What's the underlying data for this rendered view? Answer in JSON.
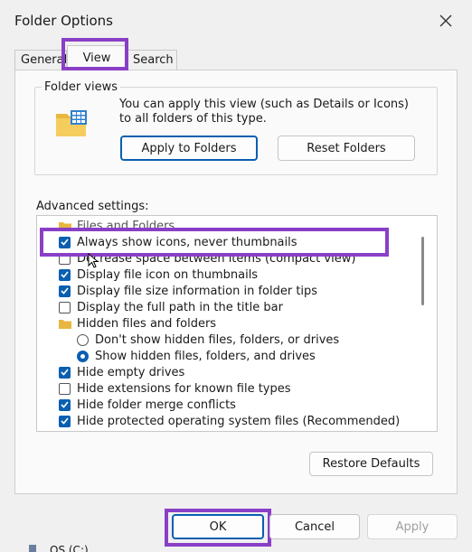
{
  "window": {
    "title": "Folder Options"
  },
  "tabs": [
    {
      "label": "General"
    },
    {
      "label": "View"
    },
    {
      "label": "Search"
    }
  ],
  "folder_views": {
    "legend": "Folder views",
    "description": "You can apply this view (such as Details or Icons) to all folders of this type.",
    "apply_button": "Apply to Folders",
    "reset_button": "Reset Folders",
    "icon": "folder-grid-icon"
  },
  "advanced": {
    "label": "Advanced settings:",
    "items": [
      {
        "type": "folder",
        "label": "Files and Folders"
      },
      {
        "type": "checkbox",
        "checked": true,
        "label": "Always show icons, never thumbnails"
      },
      {
        "type": "checkbox",
        "checked": false,
        "label": "Decrease space between items (compact view)"
      },
      {
        "type": "checkbox",
        "checked": true,
        "label": "Display file icon on thumbnails"
      },
      {
        "type": "checkbox",
        "checked": true,
        "label": "Display file size information in folder tips"
      },
      {
        "type": "checkbox",
        "checked": false,
        "label": "Display the full path in the title bar"
      },
      {
        "type": "folder",
        "label": "Hidden files and folders"
      },
      {
        "type": "radio",
        "checked": false,
        "label": "Don't show hidden files, folders, or drives"
      },
      {
        "type": "radio",
        "checked": true,
        "label": "Show hidden files, folders, and drives"
      },
      {
        "type": "checkbox",
        "checked": true,
        "label": "Hide empty drives"
      },
      {
        "type": "checkbox",
        "checked": false,
        "label": "Hide extensions for known file types"
      },
      {
        "type": "checkbox",
        "checked": true,
        "label": "Hide folder merge conflicts"
      },
      {
        "type": "checkbox",
        "checked": true,
        "label": "Hide protected operating system files (Recommended)"
      }
    ],
    "restore_button": "Restore Defaults"
  },
  "footer": {
    "ok": "OK",
    "cancel": "Cancel",
    "apply": "Apply",
    "behind_text": "OS (C:)"
  },
  "colors": {
    "accent": "#0a5fb0",
    "highlight": "#8a3fc7"
  }
}
